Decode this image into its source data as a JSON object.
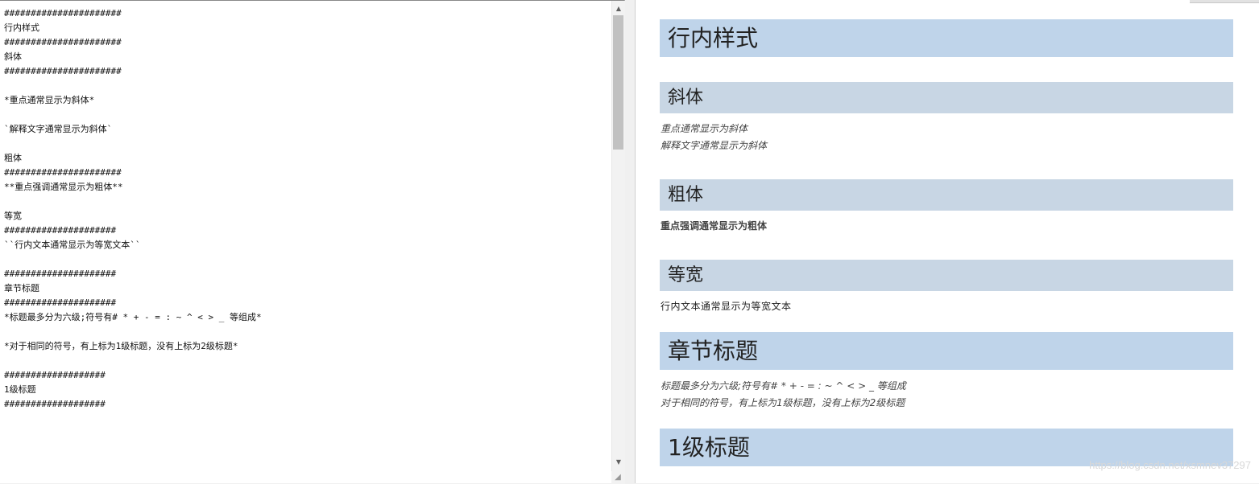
{
  "editor": {
    "lines": [
      "######################",
      "行内样式",
      "######################",
      "斜体",
      "######################",
      "",
      "*重点通常显示为斜体*",
      "",
      "`解释文字通常显示为斜体`",
      "",
      "粗体",
      "######################",
      "**重点强调通常显示为粗体**",
      "",
      "等宽",
      "#####################",
      "``行内文本通常显示为等宽文本``",
      "",
      "#####################",
      "章节标题",
      "#####################",
      "*标题最多分为六级;符号有# * + - = : ~ ^ < > _ 等组成*",
      "",
      "*对于相同的符号，有上标为1级标题，没有上标为2级标题*",
      "",
      "###################",
      "1级标题",
      "###################"
    ]
  },
  "preview": {
    "h_inline_style": "行内样式",
    "h_italic": "斜体",
    "italic_line1": "重点通常显示为斜体",
    "italic_line2": "解释文字通常显示为斜体",
    "h_bold": "粗体",
    "bold_line": "重点强调通常显示为粗体",
    "h_mono": "等宽",
    "mono_line": "行内文本通常显示为等宽文本",
    "h_section": "章节标题",
    "section_line1": "标题最多分为六级;符号有# * + - = : ~ ^ < > _ 等组成",
    "section_line2": "对于相同的符号，有上标为1级标题，没有上标为2级标题",
    "h_level1": "1级标题",
    "watermark": "https://blog.csdn.net/xsmnev37297"
  },
  "scrollbar": {
    "up_icon": "▲",
    "down_icon": "▼",
    "grip_icon": "◢"
  },
  "colors": {
    "h1_bg": "#bfd4ea",
    "h2_bg": "#c8d6e4"
  }
}
